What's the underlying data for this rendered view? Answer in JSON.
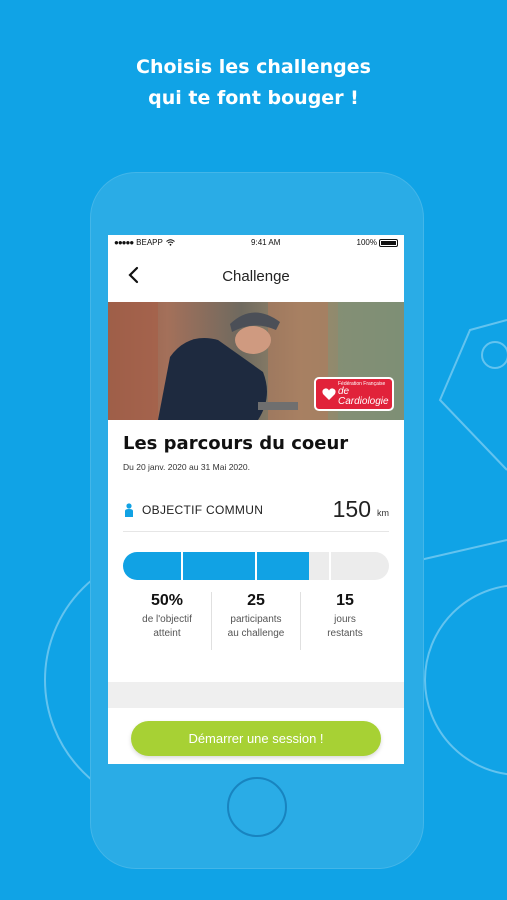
{
  "headline": {
    "line1": "Choisis les challenges",
    "line2": "qui te font bouger !"
  },
  "status_bar": {
    "carrier": "BEAPP",
    "time": "9:41 AM",
    "battery": "100%"
  },
  "nav": {
    "title": "Challenge",
    "back_icon": "chevron-left-icon"
  },
  "hero": {
    "badge_line1": "Fédération Française",
    "badge_line2": "de Cardiologie"
  },
  "challenge": {
    "title": "Les parcours du coeur",
    "dates": "Du 20 janv. 2020 au 31 Mai 2020.",
    "objective_label": "OBJECTIF COMMUN",
    "objective_value": "150",
    "objective_unit": "km",
    "progress_fraction": 0.5
  },
  "stats": [
    {
      "value": "50%",
      "label_line1": "de l'objectif",
      "label_line2": "atteint"
    },
    {
      "value": "25",
      "label_line1": "participants",
      "label_line2": "au challenge"
    },
    {
      "value": "15",
      "label_line1": "jours",
      "label_line2": "restants"
    }
  ],
  "actions": {
    "start_label": "Démarrer une session !"
  },
  "colors": {
    "background": "#10a3e6",
    "accent": "#11a2e4",
    "button": "#a7d134",
    "badge": "#e1223a"
  }
}
